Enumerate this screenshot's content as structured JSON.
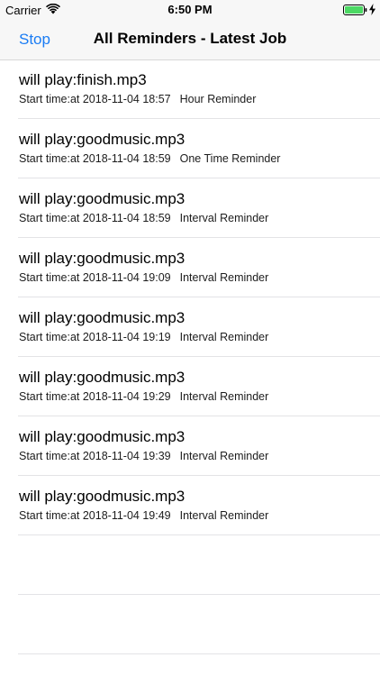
{
  "status_bar": {
    "carrier": "Carrier",
    "time": "6:50 PM",
    "battery_color": "#4cd964",
    "icons": [
      "wifi-icon",
      "battery-icon",
      "charging-bolt-icon"
    ]
  },
  "nav": {
    "stop_label": "Stop",
    "title": "All Reminders - Latest Job",
    "accent_color": "#1a7cf4"
  },
  "reminders": [
    {
      "title": "will play:finish.mp3",
      "start": "Start time:at 2018-11-04 18:57",
      "type": "Hour Reminder"
    },
    {
      "title": "will play:goodmusic.mp3",
      "start": "Start time:at 2018-11-04 18:59",
      "type": "One Time Reminder"
    },
    {
      "title": "will play:goodmusic.mp3",
      "start": "Start time:at 2018-11-04 18:59",
      "type": "Interval Reminder"
    },
    {
      "title": "will play:goodmusic.mp3",
      "start": "Start time:at 2018-11-04 19:09",
      "type": "Interval Reminder"
    },
    {
      "title": "will play:goodmusic.mp3",
      "start": "Start time:at 2018-11-04 19:19",
      "type": "Interval Reminder"
    },
    {
      "title": "will play:goodmusic.mp3",
      "start": "Start time:at 2018-11-04 19:29",
      "type": "Interval Reminder"
    },
    {
      "title": "will play:goodmusic.mp3",
      "start": "Start time:at 2018-11-04 19:39",
      "type": "Interval Reminder"
    },
    {
      "title": "will play:goodmusic.mp3",
      "start": "Start time:at 2018-11-04 19:49",
      "type": "Interval Reminder"
    }
  ]
}
